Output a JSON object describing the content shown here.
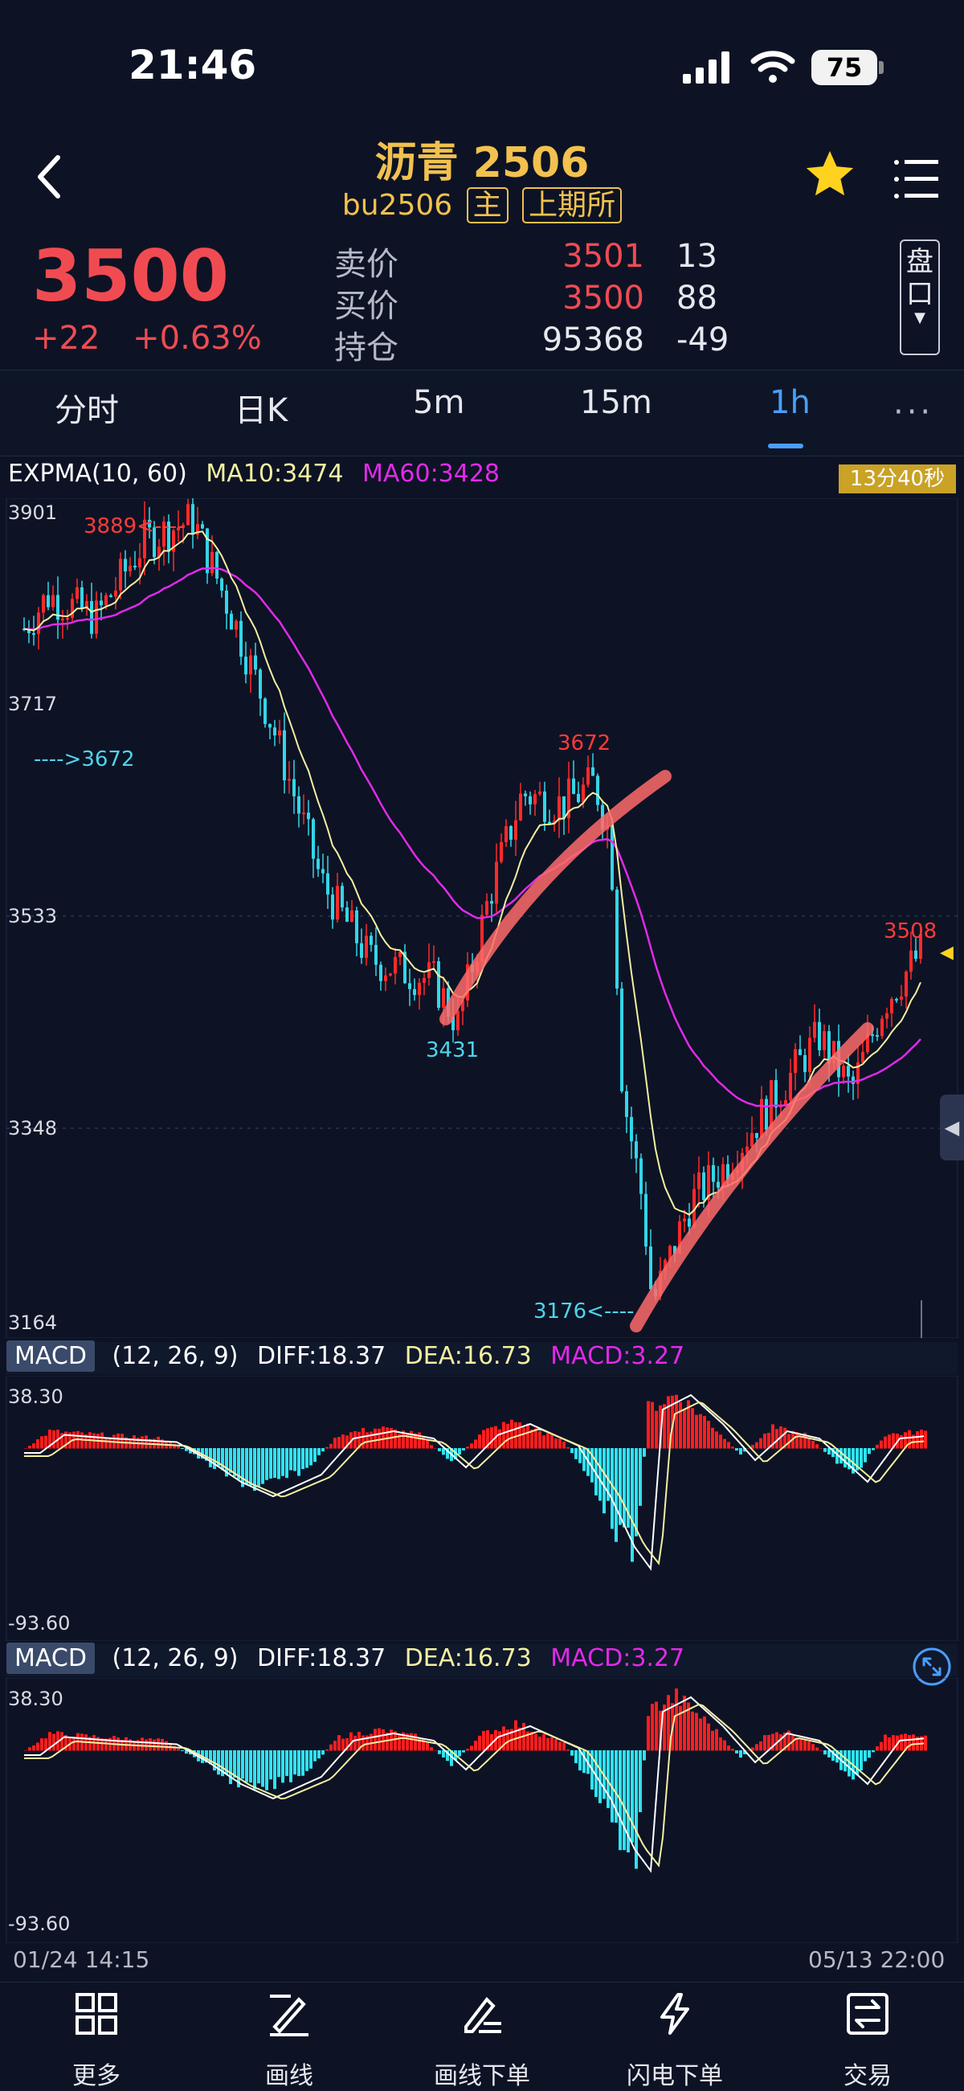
{
  "status_bar": {
    "time": "21:46",
    "battery": "75"
  },
  "header": {
    "title": "沥青 2506",
    "code": "bu2506",
    "tag_main": "主",
    "tag_exchange": "上期所"
  },
  "quote": {
    "price": "3500",
    "change": "+22",
    "change_pct": "+0.63%",
    "ask_label": "卖价",
    "ask_price": "3501",
    "ask_vol": "13",
    "bid_label": "买价",
    "bid_price": "3500",
    "bid_vol": "88",
    "oi_label": "持仓",
    "oi_value": "95368",
    "oi_change": "-49",
    "pankou_label": "盘口"
  },
  "tabs": [
    {
      "label": "分时"
    },
    {
      "label": "日K"
    },
    {
      "label": "5m"
    },
    {
      "label": "15m"
    },
    {
      "label": "1h",
      "active": true
    }
  ],
  "tabs_more": "···",
  "main_chart": {
    "indicator": "EXPMA(10, 60)",
    "ma10": "MA10:3474",
    "ma60": "MA60:3428",
    "countdown": "13分40秒",
    "y_ticks": [
      "3901",
      "3717",
      "3533",
      "3348",
      "3164"
    ],
    "annotations": {
      "high": "3889<----",
      "left_low": "---->3672",
      "mid_high": "3672",
      "mid_low": "3431",
      "low": "3176<----",
      "last_high": "3508"
    },
    "colors": {
      "up": "#ff2a2a",
      "down": "#33d6e8",
      "ma10": "#f4f0a0",
      "ma60": "#e12ae8",
      "trendline": "#ff6b6b"
    }
  },
  "macd_panels": [
    {
      "tag": "MACD",
      "params": "(12, 26, 9)",
      "diff": "DIFF:18.37",
      "dea": "DEA:16.73",
      "macd": "MACD:3.27",
      "y_top": "38.30",
      "y_bottom": "-93.60"
    },
    {
      "tag": "MACD",
      "params": "(12, 26, 9)",
      "diff": "DIFF:18.37",
      "dea": "DEA:16.73",
      "macd": "MACD:3.27",
      "y_top": "38.30",
      "y_bottom": "-93.60"
    }
  ],
  "date_axis": {
    "start": "01/24 14:15",
    "end": "05/13 22:00"
  },
  "bottom_nav": [
    {
      "label": "更多",
      "icon": "grid-icon"
    },
    {
      "label": "画线",
      "icon": "draw-line-icon"
    },
    {
      "label": "画线下单",
      "icon": "draw-order-icon"
    },
    {
      "label": "闪电下单",
      "icon": "lightning-icon"
    },
    {
      "label": "交易",
      "icon": "trade-icon"
    }
  ]
}
